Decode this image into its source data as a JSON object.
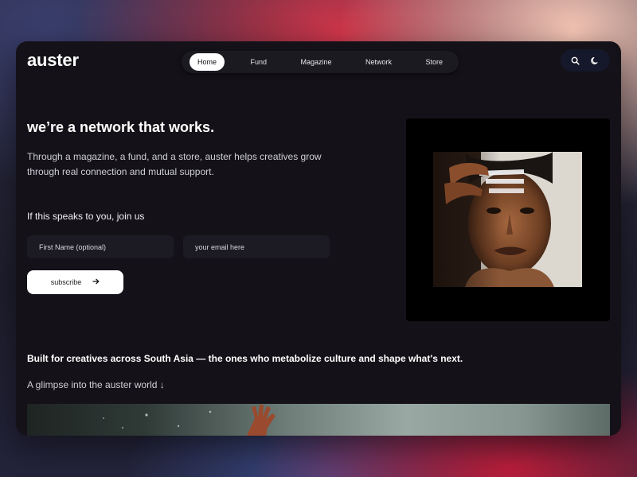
{
  "brand": {
    "logo": "auster"
  },
  "nav": {
    "items": [
      {
        "label": "Home",
        "active": true
      },
      {
        "label": "Fund",
        "active": false
      },
      {
        "label": "Magazine",
        "active": false
      },
      {
        "label": "Network",
        "active": false
      },
      {
        "label": "Store",
        "active": false
      }
    ]
  },
  "tools": {
    "search_icon": "search-icon",
    "theme_icon": "moon-icon"
  },
  "hero": {
    "headline": "we’re a network that works.",
    "intro": "Through a magazine, a fund, and a store, auster helps creatives grow through real connection and mutual support."
  },
  "signup": {
    "prompt": "If this speaks to you, join us",
    "first_name_placeholder": "First Name (optional)",
    "email_placeholder": "your email here",
    "button_label": "subscribe",
    "button_icon": "arrow-right-icon"
  },
  "statement": "Built for creatives across South Asia — the ones who metabolize culture and shape what's next.",
  "glimpse": "A glimpse into the auster world ↓",
  "colors": {
    "window_bg": "#141218",
    "accent": "#ffffff",
    "field_bg": "#1c1b24"
  }
}
